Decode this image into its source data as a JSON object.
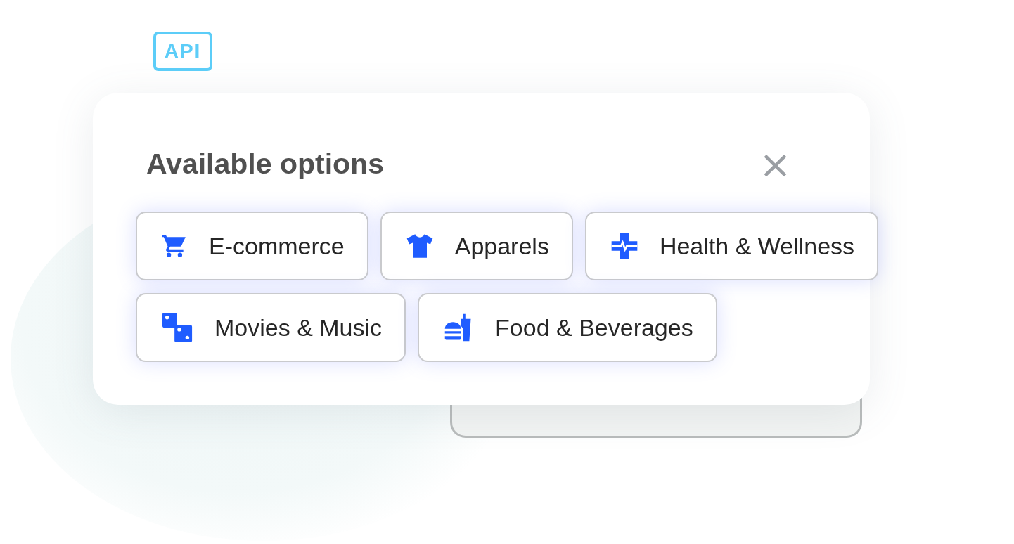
{
  "badge": {
    "label": "API"
  },
  "dialog": {
    "title": "Available options",
    "close": "×"
  },
  "options": [
    {
      "label": "E-commerce"
    },
    {
      "label": "Apparels"
    },
    {
      "label": "Health & Wellness"
    },
    {
      "label": "Movies & Music"
    },
    {
      "label": "Food & Beverages"
    }
  ]
}
